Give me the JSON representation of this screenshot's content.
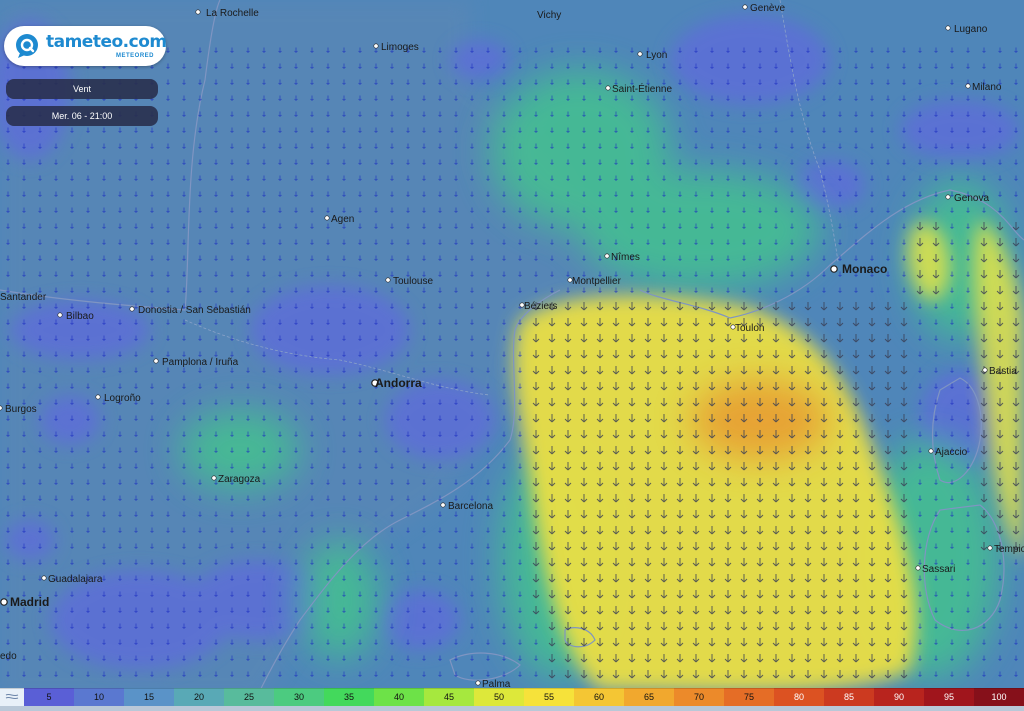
{
  "brand": {
    "name": "tameteo.com",
    "sub": "METEORED"
  },
  "layer": {
    "label": "Vent"
  },
  "time": {
    "label": "Mer. 06 - 21:00"
  },
  "colors": {
    "sea": "#4a7fb8",
    "land": "#5b86b8",
    "calm": "#5f6fd8",
    "moderate": "#3fce86",
    "strong": "#e8e14a",
    "peak": "#e88a2a",
    "border": "#8aa2c8",
    "city": "#1a1a1a",
    "arrow": "#1a2cc0"
  },
  "cities": [
    {
      "name": "La Rochelle",
      "major": false
    },
    {
      "name": "Vichy",
      "major": false
    },
    {
      "name": "Genève",
      "major": false
    },
    {
      "name": "Lugano",
      "major": false
    },
    {
      "name": "Limoges",
      "major": false
    },
    {
      "name": "Lyon",
      "major": false
    },
    {
      "name": "Milano",
      "major": false
    },
    {
      "name": "Saint-Étienne",
      "major": false
    },
    {
      "name": "Genova",
      "major": false
    },
    {
      "name": "Agen",
      "major": false
    },
    {
      "name": "Nîmes",
      "major": false
    },
    {
      "name": "Monaco",
      "major": true
    },
    {
      "name": "Toulouse",
      "major": false
    },
    {
      "name": "Montpellier",
      "major": false
    },
    {
      "name": "Béziers",
      "major": false
    },
    {
      "name": "Toulon",
      "major": false
    },
    {
      "name": "Santander",
      "major": false
    },
    {
      "name": "Bilbao",
      "major": false
    },
    {
      "name": "Donostia / San Sebastián",
      "major": false
    },
    {
      "name": "Pamplona / Iruña",
      "major": false
    },
    {
      "name": "Andorra",
      "major": true
    },
    {
      "name": "Bastia",
      "major": false
    },
    {
      "name": "Logroño",
      "major": false
    },
    {
      "name": "Burgos",
      "major": false
    },
    {
      "name": "Ajaccio",
      "major": false
    },
    {
      "name": "Zaragoza",
      "major": false
    },
    {
      "name": "Barcelona",
      "major": false
    },
    {
      "name": "Tempio",
      "major": false
    },
    {
      "name": "Guadalajara",
      "major": false
    },
    {
      "name": "Sassari",
      "major": false
    },
    {
      "name": "Madrid",
      "major": true
    },
    {
      "name": "Palma",
      "major": false
    },
    {
      "name": "edo",
      "major": false
    }
  ],
  "legend": {
    "values": [
      "5",
      "10",
      "15",
      "20",
      "25",
      "30",
      "35",
      "40",
      "45",
      "50",
      "55",
      "60",
      "65",
      "70",
      "75",
      "80",
      "85",
      "90",
      "95",
      "100"
    ],
    "colors": [
      "#5a5fd6",
      "#5a78d0",
      "#5a93c8",
      "#59a9b6",
      "#58bb9c",
      "#4ccb80",
      "#43d95c",
      "#6de248",
      "#a6e83e",
      "#dde83a",
      "#f6e23a",
      "#f4c634",
      "#f1a82e",
      "#ec8a2a",
      "#e56d26",
      "#dc5222",
      "#cc3a20",
      "#b8241e",
      "#a0151c",
      "#86101a"
    ]
  }
}
